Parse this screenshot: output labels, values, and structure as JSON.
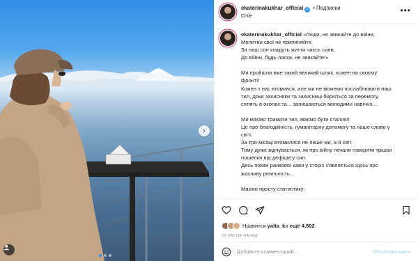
{
  "header": {
    "username": "ekaterinakukhar_official",
    "separator": "•",
    "follow_label": "Подписки",
    "location": "Chile",
    "more_label": "•••"
  },
  "caption": {
    "username": "ekaterinakukhar_official",
    "lines": [
      "«Люди, не звикайте до війни,",
      "Молитви свої не припиняйте,",
      "За наш сон кладуть життя чиєсь сини,",
      "До війни, будь-ласка, не звикайте!»",
      "",
      "Ми пройшли вже такий великий шлях, кожен на своєму",
      "фронті!",
      "Кожен з нас втомився, але ми не можемо послаблювати наш",
      "тил, доки захисники та захисниці борються за перемогу,",
      "сплять в окопах та... залишаються молодими навічно....",
      "",
      "Ми маємо тримати тил, маємо бути сталлю!",
      "Це про благодійність, гуманітарну допомогу та наше слово у",
      "світі.",
      "За три місяці втомилися не лише ми, а й світ.",
      "Тому дуже відчувається, як про війну почали говорити трішки",
      "пошепки від дефіциту сил.",
      "Десь поміж ранкової кави у сторіз з'являється щось про",
      "жахливу реальність...",
      "",
      "Маємо просту статистику:"
    ]
  },
  "actions": {
    "like_icon": "heart-icon",
    "comment_icon": "comment-icon",
    "share_icon": "share-icon",
    "save_icon": "bookmark-icon"
  },
  "likes": {
    "prefix": "Нравится ",
    "user": "yalta_k",
    "middle": " и ",
    "count_text": "ещё 4,502"
  },
  "timestamp": "23 ЧАСОВ НАЗАД",
  "comment": {
    "placeholder": "Добавьте комментарий...",
    "post_label": "Опубликовать"
  },
  "carousel": {
    "next_label": "›",
    "slide_count": 3,
    "active_slide": 1
  },
  "colors": {
    "accent": "#3897f0",
    "post_disabled": "#b2dffc",
    "story_ring": "#d62976"
  }
}
